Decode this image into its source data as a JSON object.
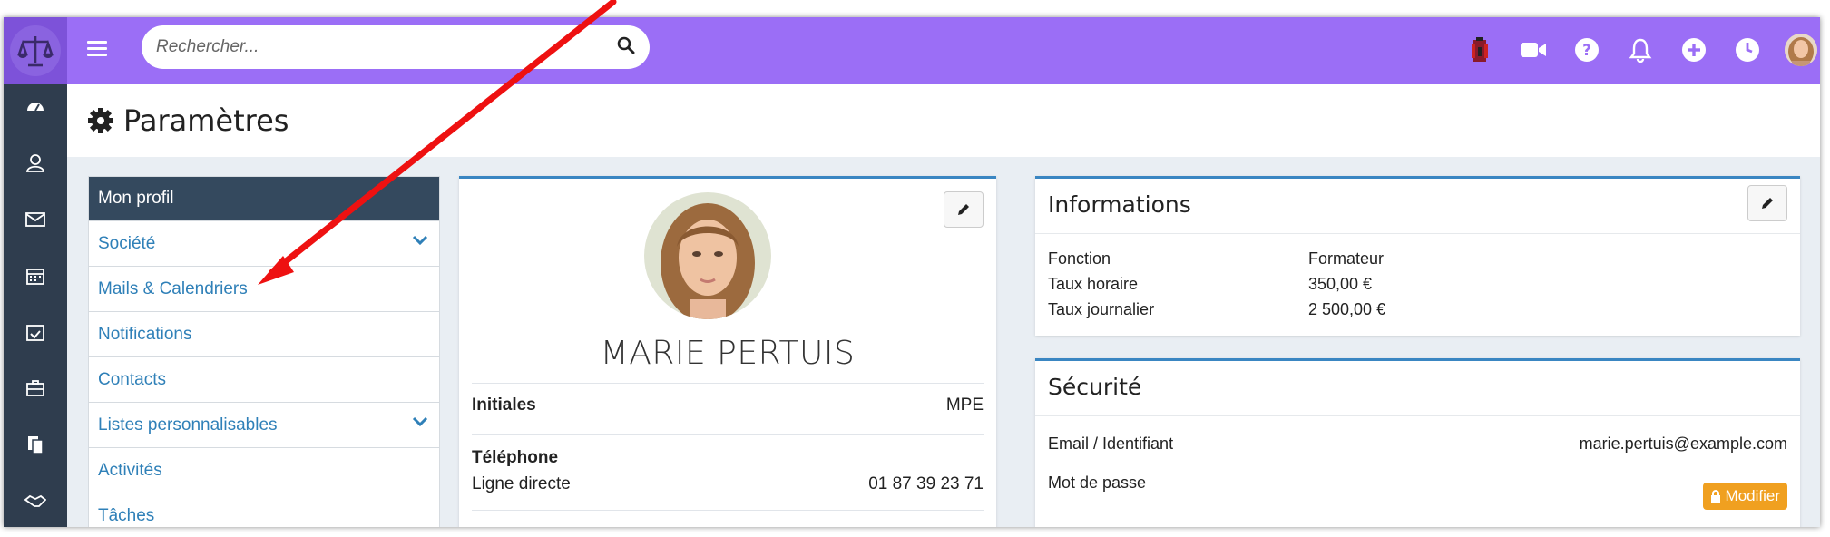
{
  "search": {
    "placeholder": "Rechercher..."
  },
  "topbar_icons": [
    "first-aid-kit-icon",
    "video-icon",
    "help-icon",
    "bell-icon",
    "plus-circle-icon",
    "clock-icon",
    "user-avatar"
  ],
  "rail_icons": [
    "dashboard-icon",
    "contacts-icon",
    "mail-icon",
    "calendar-icon",
    "tasks-icon",
    "briefcase-icon",
    "documents-icon",
    "handshake-icon"
  ],
  "page": {
    "title": "Paramètres"
  },
  "menu": {
    "header": "Mon profil",
    "items": [
      {
        "label": "Société",
        "has_chevron": true
      },
      {
        "label": "Mails & Calendriers",
        "has_chevron": false
      },
      {
        "label": "Notifications",
        "has_chevron": false
      },
      {
        "label": "Contacts",
        "has_chevron": false
      },
      {
        "label": "Listes personnalisables",
        "has_chevron": true
      },
      {
        "label": "Activités",
        "has_chevron": false
      },
      {
        "label": "Tâches",
        "has_chevron": false
      }
    ]
  },
  "profile": {
    "name": "MARIE PERTUIS",
    "initials_label": "Initiales",
    "initials_value": "MPE",
    "phone_label": "Téléphone",
    "direct_line_label": "Ligne directe",
    "direct_line_value": "01 87 39 23 71"
  },
  "informations": {
    "title": "Informations",
    "rows": [
      {
        "label": "Fonction",
        "value": "Formateur"
      },
      {
        "label": "Taux horaire",
        "value": "350,00 €"
      },
      {
        "label": "Taux journalier",
        "value": "2 500,00 €"
      }
    ]
  },
  "securite": {
    "title": "Sécurité",
    "email_label": "Email / Identifiant",
    "email_value": "marie.pertuis@example.com",
    "password_label": "Mot de passe",
    "modify_label": "Modifier"
  },
  "colors": {
    "topbar": "#9b6ef6",
    "rail": "#2f3d4e",
    "menu_header": "#34495e",
    "link": "#2f80b8",
    "card_accent": "#3a86c2",
    "modify_button": "#f0a020",
    "annotation_arrow": "#ee1111"
  }
}
